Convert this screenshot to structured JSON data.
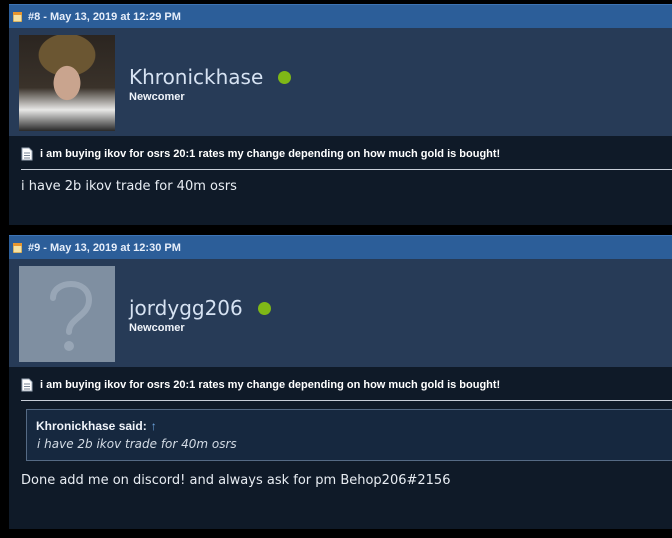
{
  "posts": [
    {
      "header": "#8 - May 13, 2019 at 12:29 PM",
      "username": "Khronickhase",
      "rank": "Newcomer",
      "avatar": "user-photo",
      "title": "i am buying ikov for osrs 20:1 rates my change depending on how much gold is bought!",
      "body": "i have 2b ikov trade for 40m osrs"
    },
    {
      "header": "#9 - May 13, 2019 at 12:30 PM",
      "username": "jordygg206",
      "rank": "Newcomer",
      "avatar": "default-avatar",
      "title": "i am buying ikov for osrs 20:1 rates my change depending on how much gold is bought!",
      "quote": {
        "author": "Khronickhase said:",
        "arrow": "↑",
        "text": "i have 2b ikov trade for 40m osrs"
      },
      "body": "Done add me on discord! and always ask for pm Behop206#2156"
    }
  ],
  "colors": {
    "header_bg": "#2c5e99",
    "userbar_bg": "#273b57",
    "post_bg": "#0f1a28",
    "online": "#7fb817"
  }
}
